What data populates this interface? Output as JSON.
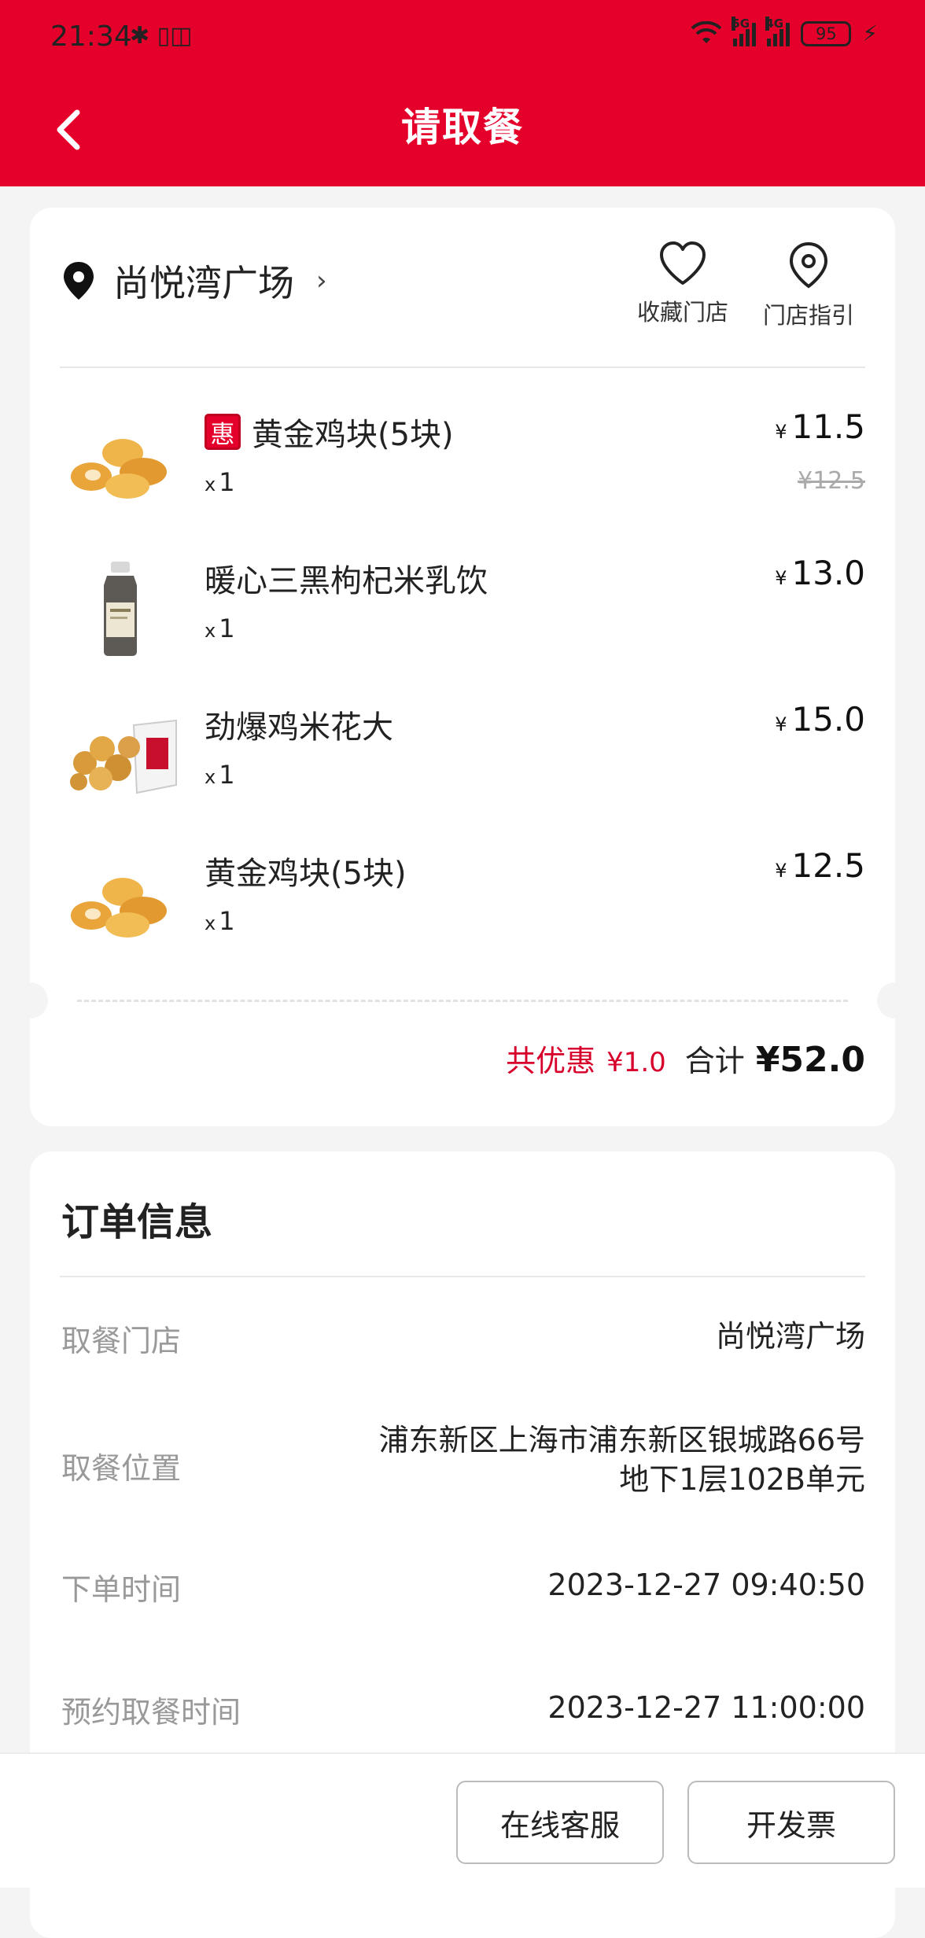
{
  "status_bar": {
    "time": "21:34",
    "left_icons": "✱ ▯◫",
    "signal_1_label": "5G",
    "signal_2_label": "4G",
    "battery": "95"
  },
  "header": {
    "title": "请取餐",
    "background_color": "#e4002b"
  },
  "store": {
    "name": "尚悦湾广场",
    "actions": [
      {
        "label": "收藏门店",
        "icon": "heart-icon"
      },
      {
        "label": "门店指引",
        "icon": "location-pin-icon"
      }
    ]
  },
  "items": [
    {
      "badge": "惠",
      "name": "黄金鸡块(5块)",
      "qty": "1",
      "currency": "¥",
      "price": "11.5",
      "original_price": "¥12.5"
    },
    {
      "name": "暖心三黑枸杞米乳饮",
      "qty": "1",
      "currency": "¥",
      "price": "13.0"
    },
    {
      "name": "劲爆鸡米花大",
      "qty": "1",
      "currency": "¥",
      "price": "15.0"
    },
    {
      "name": "黄金鸡块(5块)",
      "qty": "1",
      "currency": "¥",
      "price": "12.5"
    }
  ],
  "totals": {
    "discount_label": "共优惠",
    "discount_value": "¥1.0",
    "total_label": "合计",
    "total_value": "¥52.0"
  },
  "order_info": {
    "title": "订单信息",
    "rows": [
      {
        "label": "取餐门店",
        "value": "尚悦湾广场"
      },
      {
        "label": "取餐位置",
        "value_line1": "浦东新区上海市浦东新区银城路66号",
        "value_line2": "地下1层102B单元"
      },
      {
        "label": "下单时间",
        "value": "2023-12-27 09:40:50"
      },
      {
        "label": "预约取餐时间",
        "value": "2023-12-27 11:00:00"
      }
    ]
  },
  "bottom_bar": {
    "service_button": "在线客服",
    "invoice_button": "开发票"
  },
  "qty_prefix": "x"
}
